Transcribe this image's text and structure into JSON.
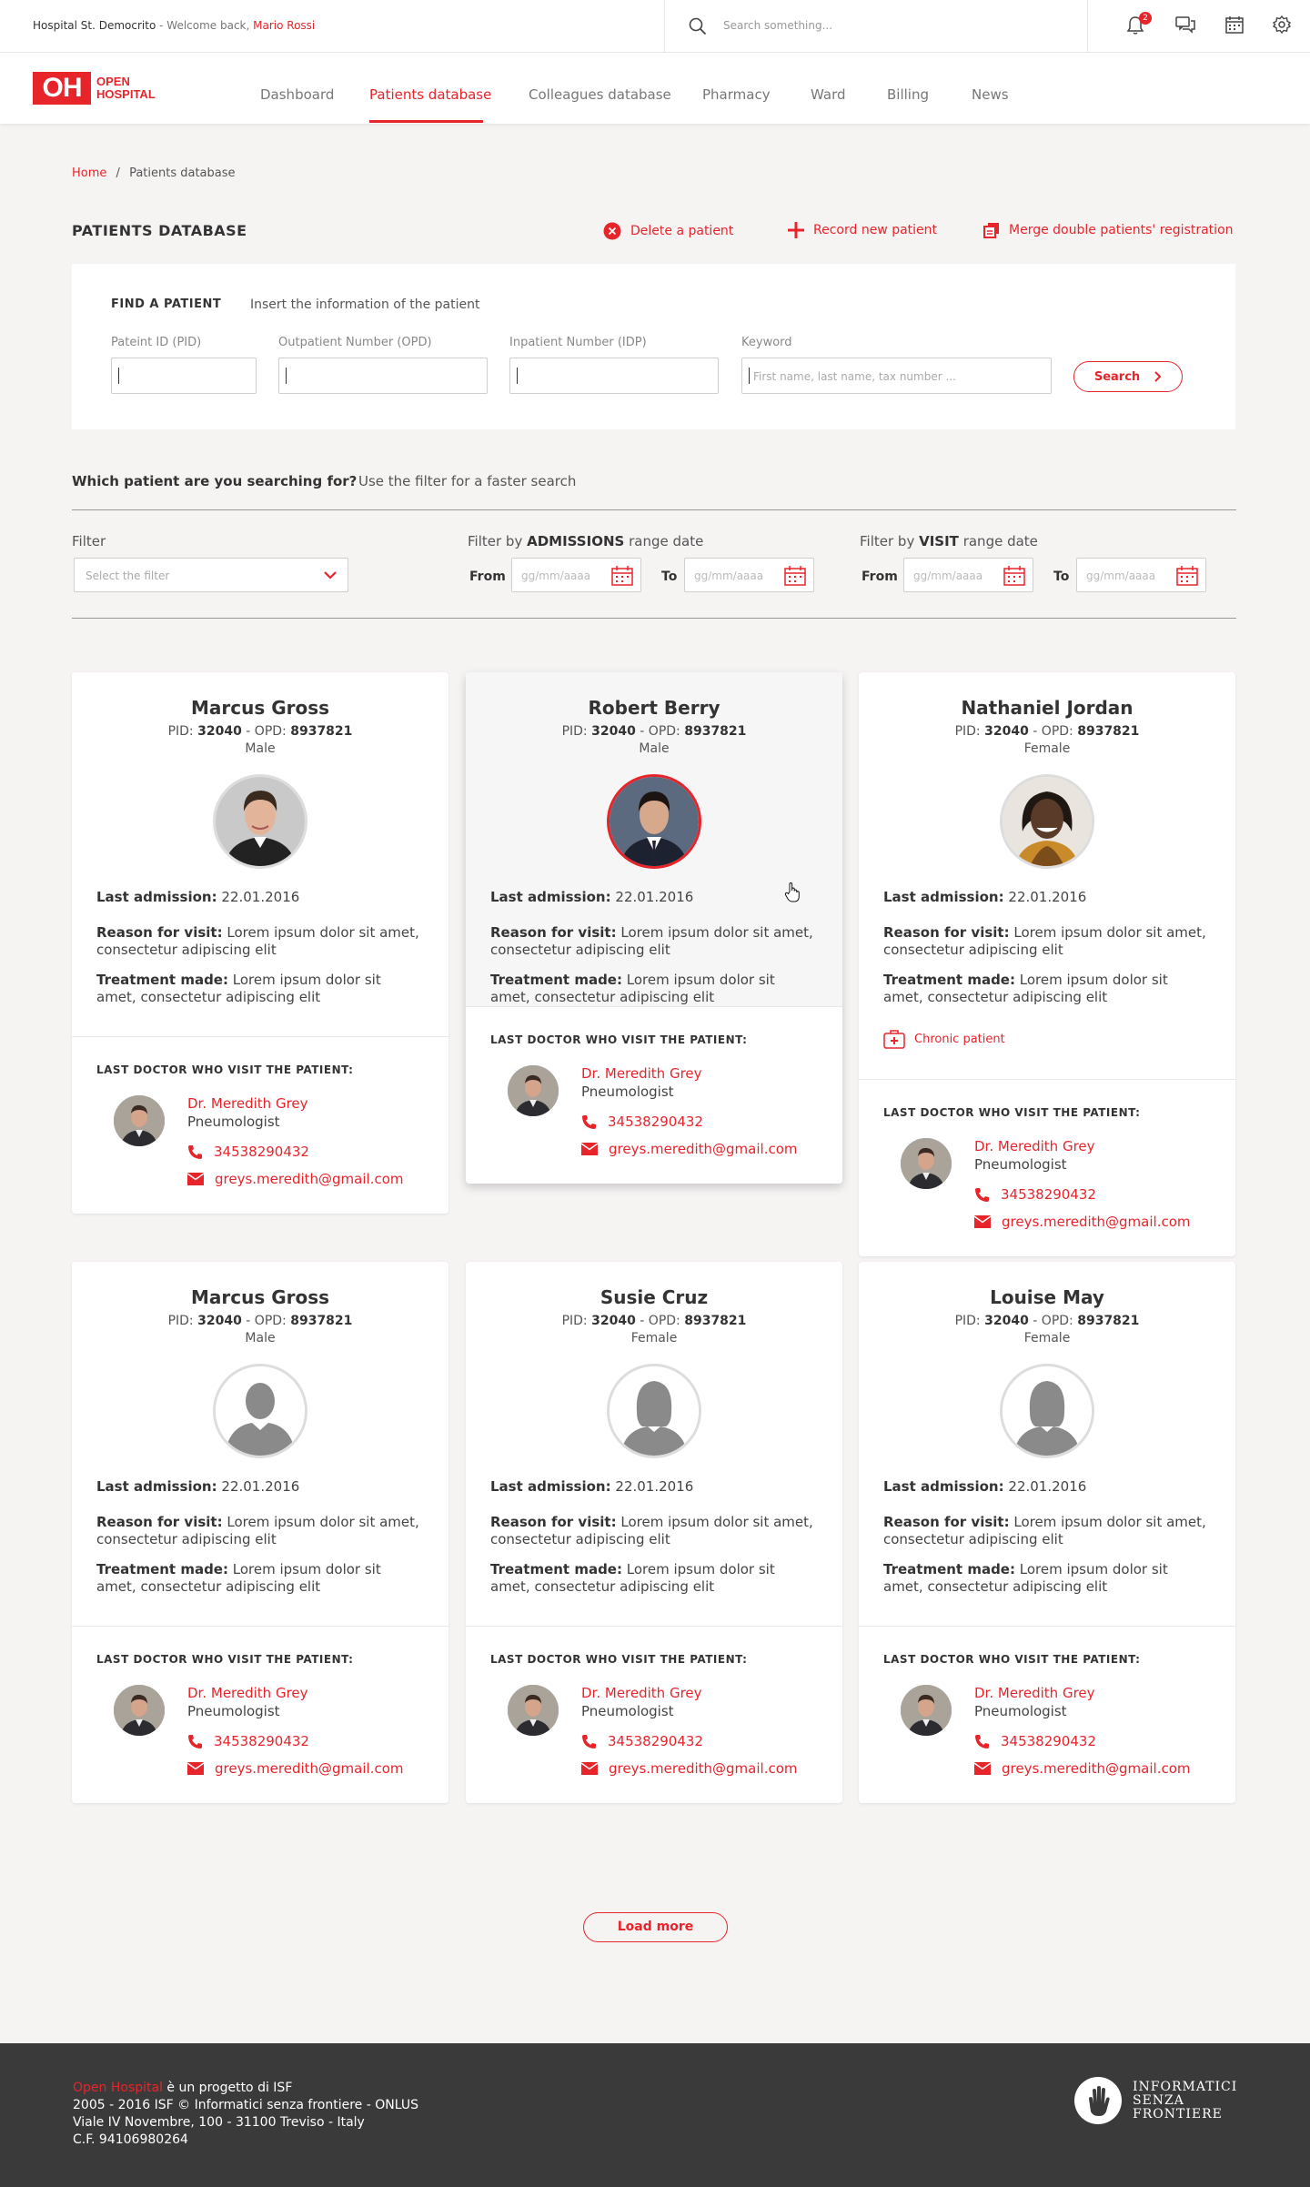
{
  "topbar": {
    "hospital": "Hospital St. Democrito",
    "welcome_text": "Welcome back,",
    "user": "Mario Rossi",
    "search_placeholder": "Search something...",
    "notifications_count": "2"
  },
  "logo": {
    "initials": "OH",
    "line1": "OPEN",
    "line2": "HOSPITAL"
  },
  "nav": [
    {
      "label": "Dashboard"
    },
    {
      "label": "Patients database"
    },
    {
      "label": "Colleagues database"
    },
    {
      "label": "Pharmacy"
    },
    {
      "label": "Ward"
    },
    {
      "label": "Billing"
    },
    {
      "label": "News"
    }
  ],
  "breadcrumb": {
    "home": "Home",
    "sep": "/",
    "current": "Patients database"
  },
  "page_title": "PATIENTS DATABASE",
  "actions": {
    "delete": "Delete a patient",
    "record": "Record new patient",
    "merge": "Merge double patients' registration"
  },
  "find": {
    "title": "FIND A PATIENT",
    "subtitle": "Insert the information of the patient",
    "pid_label": "Pateint ID (PID)",
    "opd_label": "Outpatient Number (OPD)",
    "idp_label": "Inpatient Number (IDP)",
    "keyword_label": "Keyword",
    "keyword_placeholder": "First name, last name, tax number ...",
    "search_button": "Search"
  },
  "filters": {
    "question": "Which patient are you searching for?",
    "hint": "Use the filter for a faster search",
    "filter_label": "Filter",
    "filter_placeholder": "Select the filter",
    "admissions_prefix": "Filter by",
    "admissions_bold": "ADMISSIONS",
    "admissions_suffix": "range date",
    "visit_prefix": "Filter by",
    "visit_bold": "VISIT",
    "visit_suffix": "range date",
    "from": "From",
    "to": "To",
    "date_placeholder": "gg/mm/aaaa"
  },
  "labels": {
    "pid": "PID:",
    "opd": "OPD:",
    "dash": "-",
    "last_admission": "Last admission:",
    "reason": "Reason for visit:",
    "treatment": "Treatment made:",
    "last_doctor": "LAST DOCTOR WHO VISIT THE PATIENT:",
    "chronic": "Chronic patient"
  },
  "patients": [
    {
      "name": "Marcus Gross",
      "pid": "32040",
      "opd": "8937821",
      "gender": "Male",
      "last_admission": "22.01.2016",
      "reason": "Lorem ipsum dolor sit amet, consectetur adipiscing elit",
      "treatment": "Lorem ipsum dolor sit amet, consectetur adipiscing elit",
      "doctor": "Dr. Meredith Grey",
      "role": "Pneumologist",
      "phone": "34538290432",
      "email": "greys.meredith@gmail.com"
    },
    {
      "name": "Robert Berry",
      "pid": "32040",
      "opd": "8937821",
      "gender": "Male",
      "last_admission": "22.01.2016",
      "reason": "Lorem ipsum dolor sit amet, consectetur adipiscing elit",
      "treatment": "Lorem ipsum dolor sit amet, consectetur adipiscing elit",
      "doctor": "Dr. Meredith Grey",
      "role": "Pneumologist",
      "phone": "34538290432",
      "email": "greys.meredith@gmail.com"
    },
    {
      "name": "Nathaniel Jordan",
      "pid": "32040",
      "opd": "8937821",
      "gender": "Female",
      "last_admission": "22.01.2016",
      "reason": "Lorem ipsum dolor sit amet, consectetur adipiscing elit",
      "treatment": "Lorem ipsum dolor sit amet, consectetur adipiscing elit",
      "doctor": "Dr. Meredith Grey",
      "role": "Pneumologist",
      "phone": "34538290432",
      "email": "greys.meredith@gmail.com"
    },
    {
      "name": "Marcus Gross",
      "pid": "32040",
      "opd": "8937821",
      "gender": "Male",
      "last_admission": "22.01.2016",
      "reason": "Lorem ipsum dolor sit amet, consectetur adipiscing elit",
      "treatment": "Lorem ipsum dolor sit amet, consectetur adipiscing elit",
      "doctor": "Dr. Meredith Grey",
      "role": "Pneumologist",
      "phone": "34538290432",
      "email": "greys.meredith@gmail.com"
    },
    {
      "name": "Susie Cruz",
      "pid": "32040",
      "opd": "8937821",
      "gender": "Female",
      "last_admission": "22.01.2016",
      "reason": "Lorem ipsum dolor sit amet, consectetur adipiscing elit",
      "treatment": "Lorem ipsum dolor sit amet, consectetur adipiscing elit",
      "doctor": "Dr. Meredith Grey",
      "role": "Pneumologist",
      "phone": "34538290432",
      "email": "greys.meredith@gmail.com"
    },
    {
      "name": "Louise May",
      "pid": "32040",
      "opd": "8937821",
      "gender": "Female",
      "last_admission": "22.01.2016",
      "reason": "Lorem ipsum dolor sit amet, consectetur adipiscing elit",
      "treatment": "Lorem ipsum dolor sit amet, consectetur adipiscing elit",
      "doctor": "Dr. Meredith Grey",
      "role": "Pneumologist",
      "phone": "34538290432",
      "email": "greys.meredith@gmail.com"
    }
  ],
  "load_more": "Load more",
  "footer": {
    "brand": "Open Hospital",
    "line1_rest": "è un progetto di ISF",
    "line2": "2005 - 2016 ISF © Informatici senza frontiere - ONLUS",
    "line3": "Viale IV Novembre, 100 - 31100 Treviso - Italy",
    "line4": "C.F. 94106980264",
    "isf_line1": "INFORMATICI",
    "isf_line2": "SENZA",
    "isf_line3": "FRONTIERE"
  },
  "colors": {
    "accent": "#e8242b",
    "footer": "#3a3a3a",
    "background": "#f6f3f3"
  }
}
